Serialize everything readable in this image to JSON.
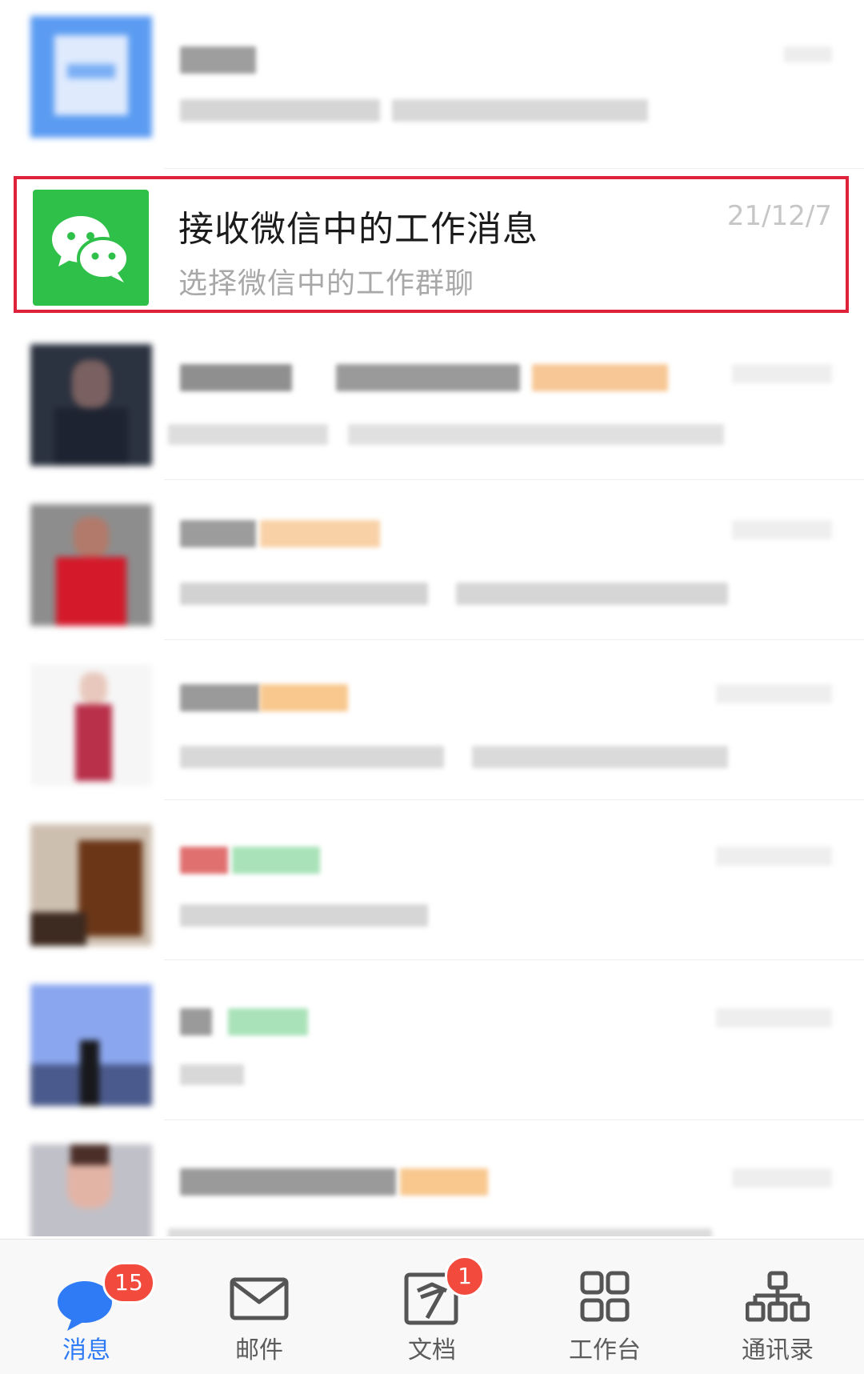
{
  "highlighted_chat": {
    "title": "接收微信中的工作消息",
    "subtitle": "选择微信中的工作群聊",
    "time": "21/12/7",
    "icon": "wechat-icon",
    "accent_color": "#2fc04a",
    "highlight_color": "#e0213a"
  },
  "tabbar": {
    "tabs": [
      {
        "label": "消息",
        "icon": "message-bubble-icon",
        "badge": "15",
        "active": true
      },
      {
        "label": "邮件",
        "icon": "mail-icon",
        "badge": ""
      },
      {
        "label": "文档",
        "icon": "document-icon",
        "badge": "1"
      },
      {
        "label": "工作台",
        "icon": "grid-icon",
        "badge": ""
      },
      {
        "label": "通讯录",
        "icon": "org-chart-icon",
        "badge": ""
      }
    ],
    "active_color": "#2f7bf5",
    "badge_color": "#f24a3c"
  }
}
